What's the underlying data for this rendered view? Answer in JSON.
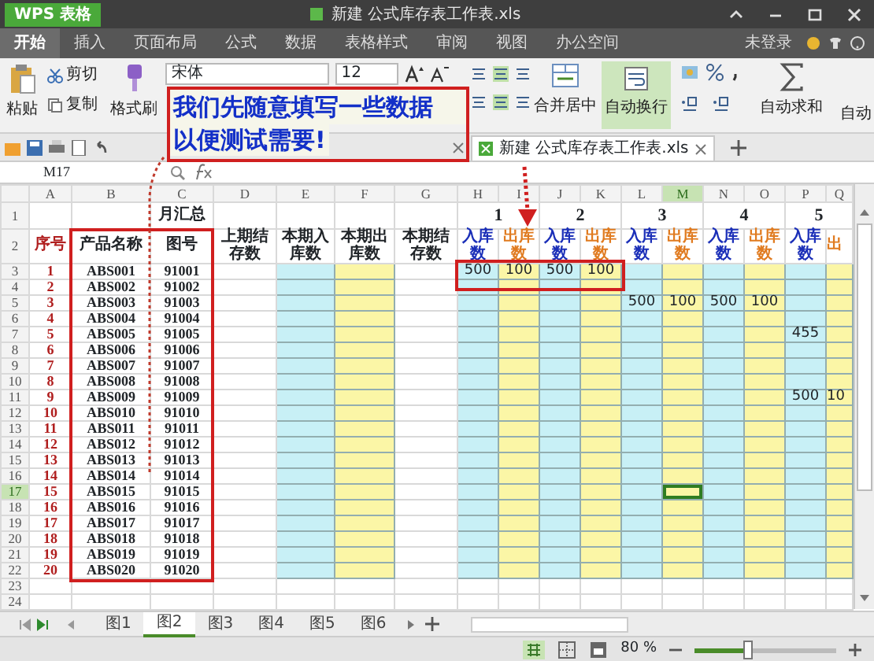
{
  "title_bar": {
    "app_button": "WPS 表格",
    "title": "新建 公式库存表工作表.xls"
  },
  "menu_tabs": [
    {
      "label": "开始",
      "selected": true
    },
    {
      "label": "插入",
      "selected": false
    },
    {
      "label": "页面布局",
      "selected": false
    },
    {
      "label": "公式",
      "selected": false
    },
    {
      "label": "数据",
      "selected": false
    },
    {
      "label": "表格样式",
      "selected": false
    },
    {
      "label": "审阅",
      "selected": false
    },
    {
      "label": "视图",
      "selected": false
    },
    {
      "label": "办公空间",
      "selected": false
    }
  ],
  "account": "未登录",
  "ribbon": {
    "paste": "粘贴",
    "cut": "剪切",
    "copy": "复制",
    "format_painter": "格式刷",
    "font_name": "宋体",
    "font_size": "12",
    "merge": "合并居中",
    "wrap_text": {
      "label": "自动换行",
      "on": true
    },
    "autosum": "自动求和",
    "next_command": "自动"
  },
  "document_tab": {
    "label": "新建 公式库存表工作表.xls"
  },
  "formula_bar": {
    "name_box": "M17"
  },
  "sheet": {
    "columns": [
      {
        "letter": "A",
        "kind": "index",
        "selected": false
      },
      {
        "letter": "B",
        "kind": "text",
        "selected": false
      },
      {
        "letter": "C",
        "kind": "text",
        "selected": false
      },
      {
        "letter": "D",
        "kind": "plain",
        "selected": false
      },
      {
        "letter": "E",
        "kind": "in_total",
        "selected": false
      },
      {
        "letter": "F",
        "kind": "out_total",
        "selected": false
      },
      {
        "letter": "G",
        "kind": "plain",
        "selected": false
      },
      {
        "letter": "H",
        "kind": "in",
        "selected": false
      },
      {
        "letter": "I",
        "kind": "out",
        "selected": false
      },
      {
        "letter": "J",
        "kind": "in",
        "selected": false
      },
      {
        "letter": "K",
        "kind": "out",
        "selected": false
      },
      {
        "letter": "L",
        "kind": "in",
        "selected": false
      },
      {
        "letter": "M",
        "kind": "out",
        "selected": true
      },
      {
        "letter": "N",
        "kind": "in",
        "selected": false
      },
      {
        "letter": "O",
        "kind": "out",
        "selected": false
      },
      {
        "letter": "P",
        "kind": "in",
        "selected": false
      },
      {
        "letter": "Q",
        "kind": "out",
        "selected": false
      }
    ],
    "rows": [
      {
        "number": "1",
        "kind": "title",
        "selected": false,
        "cells": {
          "C": "月汇总",
          "H": "1",
          "J": "2",
          "L": "3",
          "N": "4",
          "P": "5"
        }
      },
      {
        "number": "2",
        "kind": "header",
        "selected": false,
        "cells": {
          "A": "序号",
          "B": "产品名称",
          "C": "图号",
          "D": "上期结存数",
          "E": "本期入库数",
          "F": "本期出库数",
          "G": "本期结存数",
          "H": "入库数",
          "I": "出库数",
          "J": "入库数",
          "K": "出库数",
          "L": "入库数",
          "M": "出库数",
          "N": "入库数",
          "O": "出库数",
          "P": "入库数",
          "Q": "出"
        }
      },
      {
        "number": "3",
        "kind": "data",
        "selected": false,
        "cells": {
          "A": "1",
          "B": "ABS001",
          "C": "91001",
          "H": "500",
          "I": "100",
          "J": "500",
          "K": "100"
        }
      },
      {
        "number": "4",
        "kind": "data",
        "selected": false,
        "cells": {
          "A": "2",
          "B": "ABS002",
          "C": "91002"
        }
      },
      {
        "number": "5",
        "kind": "data",
        "selected": false,
        "cells": {
          "A": "3",
          "B": "ABS003",
          "C": "91003",
          "L": "500",
          "M": "100",
          "N": "500",
          "O": "100"
        }
      },
      {
        "number": "6",
        "kind": "data",
        "selected": false,
        "cells": {
          "A": "4",
          "B": "ABS004",
          "C": "91004"
        }
      },
      {
        "number": "7",
        "kind": "data",
        "selected": false,
        "cells": {
          "A": "5",
          "B": "ABS005",
          "C": "91005",
          "P": "455"
        }
      },
      {
        "number": "8",
        "kind": "data",
        "selected": false,
        "cells": {
          "A": "6",
          "B": "ABS006",
          "C": "91006"
        }
      },
      {
        "number": "9",
        "kind": "data",
        "selected": false,
        "cells": {
          "A": "7",
          "B": "ABS007",
          "C": "91007"
        }
      },
      {
        "number": "10",
        "kind": "data",
        "selected": false,
        "cells": {
          "A": "8",
          "B": "ABS008",
          "C": "91008"
        }
      },
      {
        "number": "11",
        "kind": "data",
        "selected": false,
        "cells": {
          "A": "9",
          "B": "ABS009",
          "C": "91009",
          "P": "500",
          "Q": "10"
        }
      },
      {
        "number": "12",
        "kind": "data",
        "selected": false,
        "cells": {
          "A": "10",
          "B": "ABS010",
          "C": "91010"
        }
      },
      {
        "number": "13",
        "kind": "data",
        "selected": false,
        "cells": {
          "A": "11",
          "B": "ABS011",
          "C": "91011"
        }
      },
      {
        "number": "14",
        "kind": "data",
        "selected": false,
        "cells": {
          "A": "12",
          "B": "ABS012",
          "C": "91012"
        }
      },
      {
        "number": "15",
        "kind": "data",
        "selected": false,
        "cells": {
          "A": "13",
          "B": "ABS013",
          "C": "91013"
        }
      },
      {
        "number": "16",
        "kind": "data",
        "selected": false,
        "cells": {
          "A": "14",
          "B": "ABS014",
          "C": "91014"
        }
      },
      {
        "number": "17",
        "kind": "data",
        "selected": true,
        "cells": {
          "A": "15",
          "B": "ABS015",
          "C": "91015"
        }
      },
      {
        "number": "18",
        "kind": "data",
        "selected": false,
        "cells": {
          "A": "16",
          "B": "ABS016",
          "C": "91016"
        }
      },
      {
        "number": "19",
        "kind": "data",
        "selected": false,
        "cells": {
          "A": "17",
          "B": "ABS017",
          "C": "91017"
        }
      },
      {
        "number": "20",
        "kind": "data",
        "selected": false,
        "cells": {
          "A": "18",
          "B": "ABS018",
          "C": "91018"
        }
      },
      {
        "number": "21",
        "kind": "data",
        "selected": false,
        "cells": {
          "A": "19",
          "B": "ABS019",
          "C": "91019"
        }
      },
      {
        "number": "22",
        "kind": "data",
        "selected": false,
        "cells": {
          "A": "20",
          "B": "ABS020",
          "C": "91020"
        }
      },
      {
        "number": "23",
        "kind": "blank",
        "selected": false,
        "cells": {}
      },
      {
        "number": "24",
        "kind": "blank",
        "selected": false,
        "cells": {}
      }
    ]
  },
  "sheet_tabs": [
    {
      "label": "图1",
      "selected": false
    },
    {
      "label": "图2",
      "selected": true
    },
    {
      "label": "图3",
      "selected": false
    },
    {
      "label": "图4",
      "selected": false
    },
    {
      "label": "图5",
      "selected": false
    },
    {
      "label": "图6",
      "selected": false
    }
  ],
  "status_bar": {
    "zoom": "80 %",
    "zoom_slider": {
      "level": 0.38
    }
  },
  "callout": {
    "lines": [
      "我们先随意填写一些数据",
      "以便测试需要!"
    ]
  }
}
